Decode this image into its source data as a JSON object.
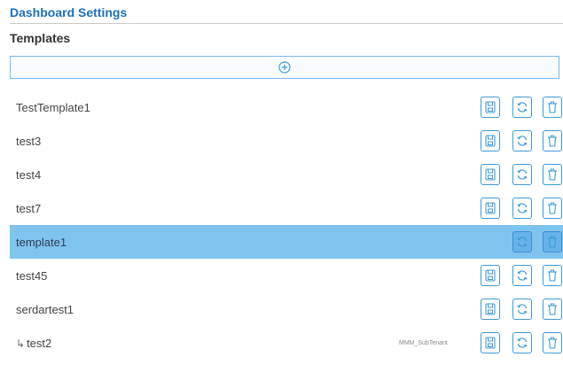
{
  "header": {
    "title": "Dashboard Settings",
    "section": "Templates"
  },
  "add_bar": {
    "icon": "plus-circle-icon"
  },
  "templates": [
    {
      "label": "TestTemplate1",
      "sub": "",
      "child": false,
      "selected": false,
      "has_save": true
    },
    {
      "label": "test3",
      "sub": "",
      "child": false,
      "selected": false,
      "has_save": true
    },
    {
      "label": "test4",
      "sub": "",
      "child": false,
      "selected": false,
      "has_save": true
    },
    {
      "label": "test7",
      "sub": "",
      "child": false,
      "selected": false,
      "has_save": true
    },
    {
      "label": "template1",
      "sub": "",
      "child": false,
      "selected": true,
      "has_save": false
    },
    {
      "label": "test45",
      "sub": "",
      "child": false,
      "selected": false,
      "has_save": true
    },
    {
      "label": "serdartest1",
      "sub": "",
      "child": false,
      "selected": false,
      "has_save": true
    },
    {
      "label": "test2",
      "sub": "MMM_SubTenant",
      "child": true,
      "selected": false,
      "has_save": true
    }
  ],
  "row_actions": {
    "save_icon": "save-icon",
    "refresh_icon": "refresh-icon",
    "delete_icon": "trash-icon"
  },
  "colors": {
    "accent": "#1d70b8",
    "button_border": "#3c9ad8",
    "selected_row": "#7fc3ef"
  }
}
